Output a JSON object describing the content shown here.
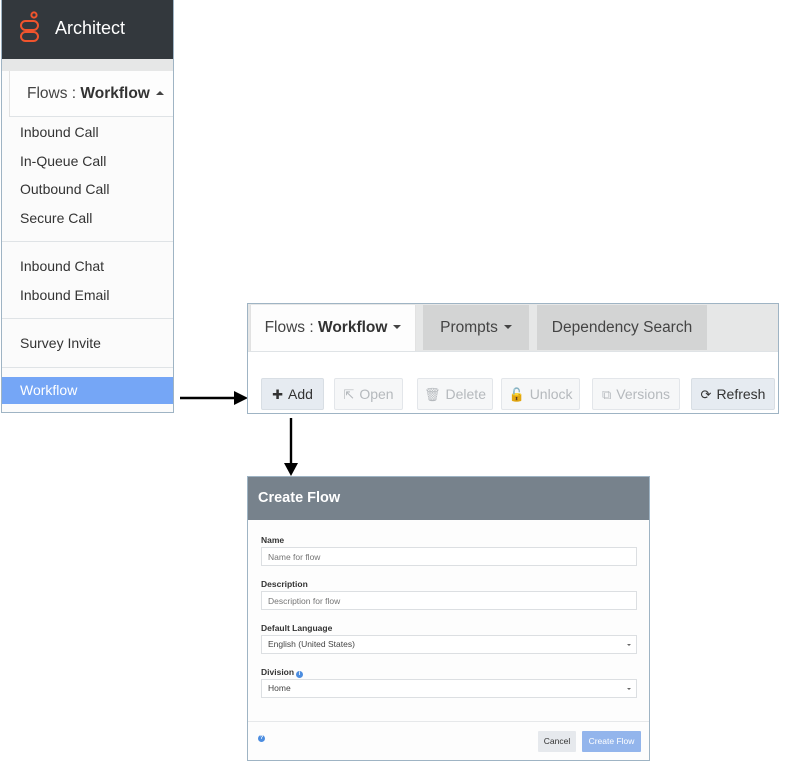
{
  "app": {
    "title": "Architect",
    "logo_icon": "genesys-logo-icon",
    "brand_color": "#f0542d"
  },
  "left_panel": {
    "flows_toggle": {
      "prefix": "Flows : ",
      "value": "Workflow",
      "caret_icon": "caret-up-icon"
    },
    "menu_groups": [
      {
        "items": [
          "Inbound Call",
          "In-Queue Call",
          "Outbound Call",
          "Secure Call"
        ]
      },
      {
        "items": [
          "Inbound Chat",
          "Inbound Email"
        ]
      },
      {
        "items": [
          "Survey Invite"
        ]
      },
      {
        "items": [
          "Workflow"
        ]
      }
    ],
    "selected_item": "Workflow",
    "selected_color": "#75a6f6"
  },
  "toolbar_panel": {
    "tabs": [
      {
        "prefix": "Flows : ",
        "value": "Workflow",
        "has_caret": true,
        "active": true
      },
      {
        "label": "Prompts",
        "has_caret": true,
        "active": false
      },
      {
        "label": "Dependency Search",
        "has_caret": false,
        "active": false
      }
    ],
    "buttons": [
      {
        "label": "Add",
        "icon": "plus-icon",
        "glyph": "✚",
        "enabled": true
      },
      {
        "label": "Open",
        "icon": "open-external-icon",
        "glyph": "⇱",
        "enabled": false
      },
      {
        "label": "Delete",
        "icon": "trash-icon",
        "glyph": "🗑",
        "enabled": false
      },
      {
        "label": "Unlock",
        "icon": "unlock-icon",
        "glyph": "🔓",
        "enabled": false
      },
      {
        "label": "Versions",
        "icon": "versions-icon",
        "glyph": "⧉",
        "enabled": false
      },
      {
        "label": "Refresh",
        "icon": "refresh-icon",
        "glyph": "⟳",
        "enabled": true
      }
    ]
  },
  "dialog": {
    "title": "Create Flow",
    "header_color": "#77828c",
    "fields": {
      "name": {
        "label": "Name",
        "placeholder": "Name for flow",
        "value": ""
      },
      "description": {
        "label": "Description",
        "placeholder": "Description for flow",
        "value": ""
      },
      "default_language": {
        "label": "Default Language",
        "value": "English (United States)"
      },
      "division": {
        "label": "Division",
        "value": "Home",
        "info_icon": "info-icon"
      }
    },
    "help_icon": "question-circle-icon",
    "buttons": {
      "cancel": "Cancel",
      "create": "Create Flow"
    },
    "create_button_color": "#93b5ec"
  }
}
